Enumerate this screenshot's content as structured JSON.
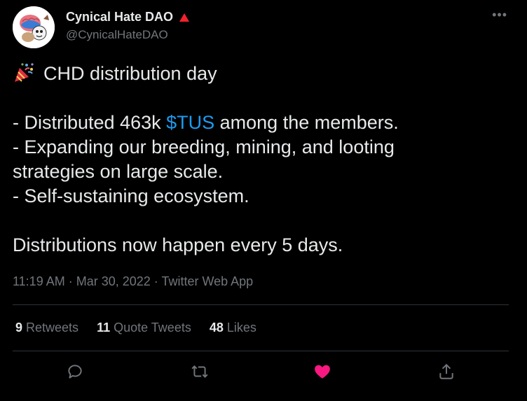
{
  "author": {
    "display_name": "Cynical Hate DAO",
    "handle": "@CynicalHateDAO",
    "badge_color": "#f4212e"
  },
  "tweet": {
    "lines": [
      "CHD distribution day",
      "",
      "- Distributed 463k ",
      "- Expanding our breeding, mining, and looting",
      "strategies on large scale.",
      "- Self-sustaining ecosystem.",
      "",
      "Distributions now happen every 5 days."
    ],
    "cashtag": "$TUS",
    "after_cashtag": " among the members.",
    "emoji": "party-popper-icon"
  },
  "meta": {
    "time": "11:19 AM",
    "separator": " · ",
    "date": "Mar 30, 2022",
    "source": "Twitter Web App"
  },
  "stats": {
    "retweets_count": "9",
    "retweets_label": "Retweets",
    "quotes_count": "11",
    "quotes_label": "Quote Tweets",
    "likes_count": "48",
    "likes_label": "Likes"
  },
  "actions": {
    "reply": "reply-icon",
    "retweet": "retweet-icon",
    "like": "heart-icon",
    "share": "share-icon",
    "like_color": "#f91880",
    "icon_color": "#71767b"
  },
  "colors": {
    "background": "#000000",
    "text": "#e7e9ea",
    "secondary": "#71767b",
    "link": "#1d9bf0",
    "divider": "#2f3336"
  }
}
